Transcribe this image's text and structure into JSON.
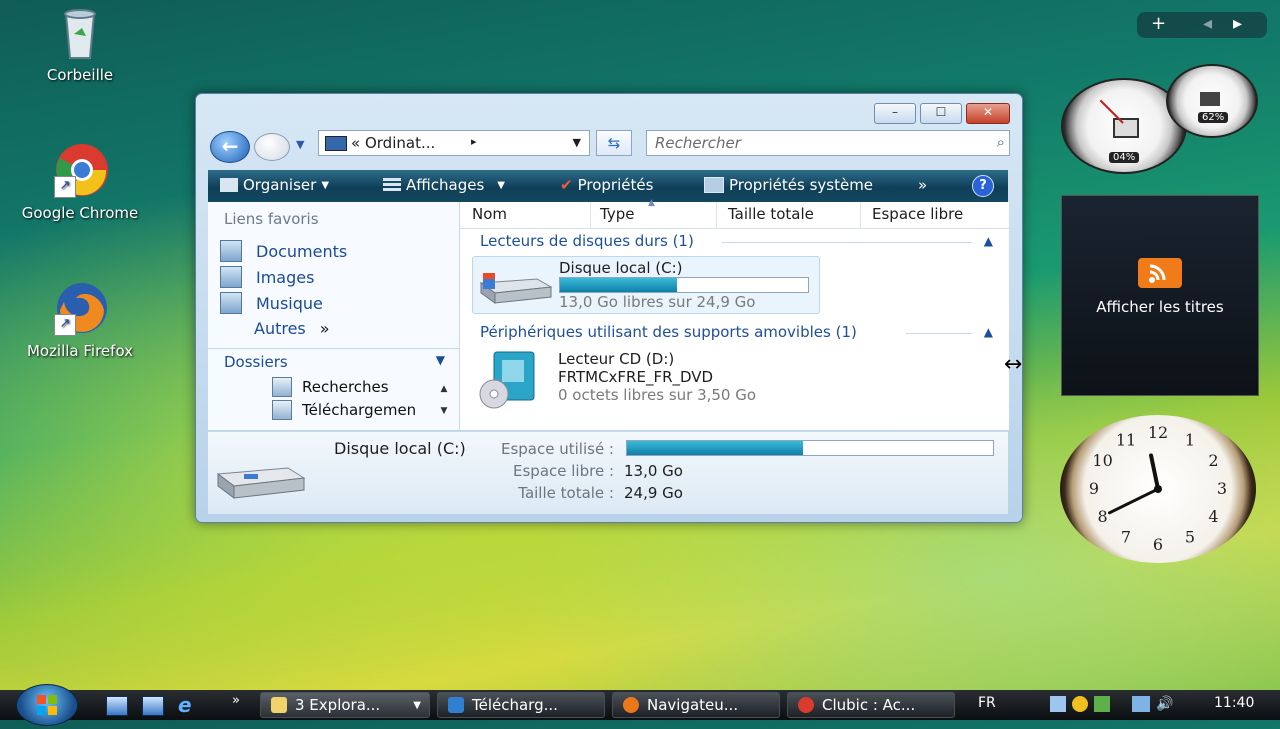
{
  "desktop": {
    "icons": [
      {
        "label": "Corbeille"
      },
      {
        "label": "Google Chrome"
      },
      {
        "label": "Mozilla Firefox"
      }
    ]
  },
  "explorer": {
    "window_buttons": {
      "minimize": "–",
      "maximize": "☐",
      "close": "✕"
    },
    "address": {
      "prefix": "«",
      "text": "Ordinat...",
      "separator": "▸"
    },
    "search": {
      "placeholder": "Rechercher"
    },
    "toolbar": {
      "organiser": "Organiser",
      "affichages": "Affichages",
      "proprietes": "Propriétés",
      "proprietes_systeme": "Propriétés système",
      "more": "»",
      "help": "?"
    },
    "navpane": {
      "favorites_header": "Liens favoris",
      "favorites": [
        {
          "label": "Documents"
        },
        {
          "label": "Images"
        },
        {
          "label": "Musique"
        }
      ],
      "autres": "Autres",
      "autres_chevron": "»",
      "folders_header": "Dossiers",
      "tree": [
        {
          "label": "Recherches"
        },
        {
          "label": "Téléchargemen"
        }
      ]
    },
    "columns": [
      "Nom",
      "Type",
      "Taille totale",
      "Espace libre"
    ],
    "groups": [
      {
        "title": "Lecteurs de disques durs (1)",
        "items": [
          {
            "name": "Disque local (C:)",
            "usage_fraction": 0.47,
            "subtitle": "13,0 Go libres sur 24,9 Go"
          }
        ]
      },
      {
        "title": "Périphériques utilisant des supports amovibles (1)",
        "items": [
          {
            "name": "Lecteur CD (D:)",
            "label": "FRTMCxFRE_FR_DVD",
            "subtitle": "0 octets libres sur 3,50 Go"
          }
        ]
      }
    ],
    "details": {
      "name": "Disque local (C:)",
      "used_label": "Espace utilisé :",
      "used_fraction": 0.48,
      "free_label": "Espace libre :",
      "free_value": "13,0 Go",
      "total_label": "Taille totale :",
      "total_value": "24,9 Go"
    }
  },
  "gadgets": {
    "sidebar_controls": {
      "add": "+",
      "prev": "◂",
      "next": "▸"
    },
    "cpu_percent": "04%",
    "memory_percent": "62%",
    "feed_label": "Afficher les titres",
    "clock": {
      "numbers": [
        "12",
        "1",
        "2",
        "3",
        "4",
        "5",
        "6",
        "7",
        "8",
        "9",
        "10",
        "11"
      ],
      "time_hours": 11,
      "time_minutes": 40
    }
  },
  "taskbar": {
    "quicklaunch_more": "»",
    "tasks": [
      {
        "label": "3 Explora..."
      },
      {
        "label": "Télécharg..."
      },
      {
        "label": "Navigateu..."
      },
      {
        "label": "Clubic : Ac..."
      }
    ],
    "language": "FR",
    "time": "11:40"
  },
  "colors": {
    "accent": "#1d4f9f",
    "progress": "#1689b4",
    "toolbar": "#13485f"
  }
}
